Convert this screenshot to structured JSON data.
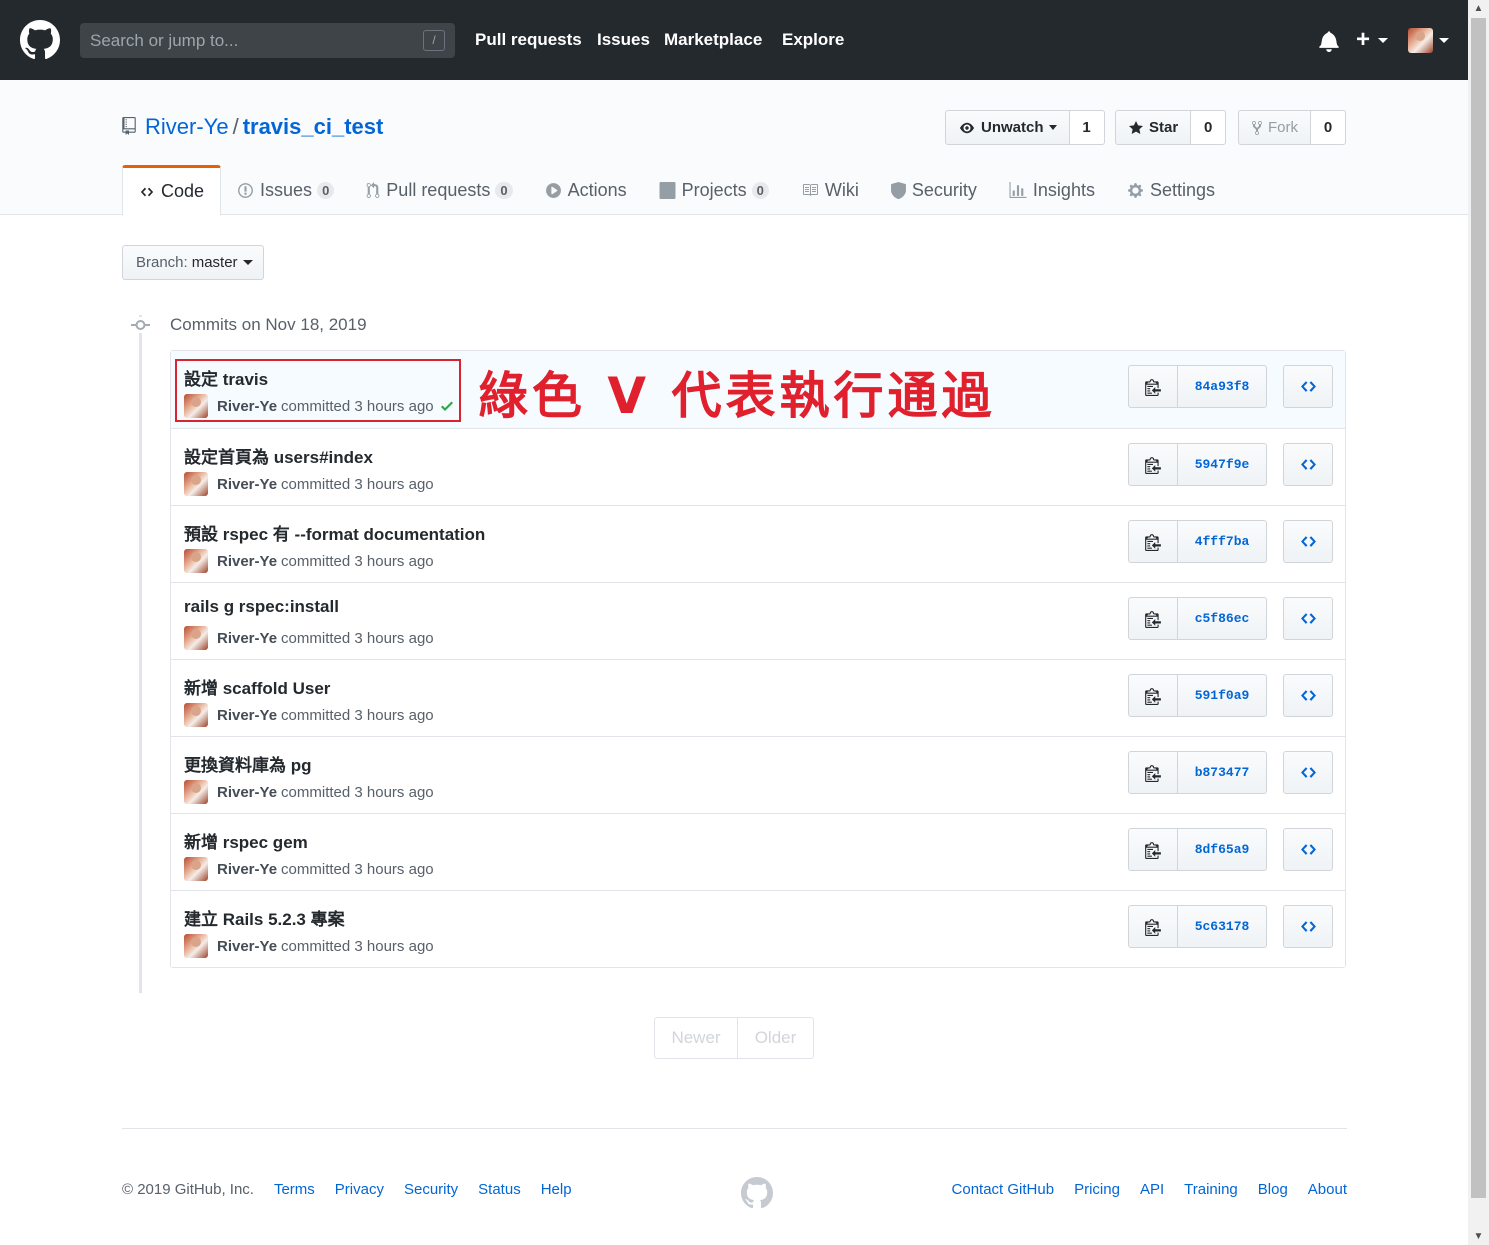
{
  "header": {
    "search_placeholder": "Search or jump to...",
    "slash_key": "/",
    "nav": [
      "Pull requests",
      "Issues",
      "Marketplace",
      "Explore"
    ]
  },
  "repo": {
    "owner": "River-Ye",
    "separator": "/",
    "name": "travis_ci_test",
    "watch_label": "Unwatch",
    "watch_count": "1",
    "star_label": "Star",
    "star_count": "0",
    "fork_label": "Fork",
    "fork_count": "0"
  },
  "tabs": [
    {
      "label": "Code",
      "count": null,
      "icon": "code-icon"
    },
    {
      "label": "Issues",
      "count": "0",
      "icon": "issue-icon"
    },
    {
      "label": "Pull requests",
      "count": "0",
      "icon": "pull-request-icon"
    },
    {
      "label": "Actions",
      "count": null,
      "icon": "play-icon"
    },
    {
      "label": "Projects",
      "count": "0",
      "icon": "project-icon"
    },
    {
      "label": "Wiki",
      "count": null,
      "icon": "book-icon"
    },
    {
      "label": "Security",
      "count": null,
      "icon": "shield-icon"
    },
    {
      "label": "Insights",
      "count": null,
      "icon": "graph-icon"
    },
    {
      "label": "Settings",
      "count": null,
      "icon": "gear-icon"
    }
  ],
  "branch": {
    "label": "Branch:",
    "value": "master"
  },
  "commits_group_title": "Commits on Nov 18, 2019",
  "commits": [
    {
      "message": "設定 travis",
      "author": "River-Ye",
      "time": "committed 3 hours ago",
      "sha": "84a93f8",
      "status": "success"
    },
    {
      "message": "設定首頁為 users#index",
      "author": "River-Ye",
      "time": "committed 3 hours ago",
      "sha": "5947f9e",
      "status": ""
    },
    {
      "message": "預設 rspec 有 --format documentation",
      "author": "River-Ye",
      "time": "committed 3 hours ago",
      "sha": "4fff7ba",
      "status": ""
    },
    {
      "message": "rails g rspec:install",
      "author": "River-Ye",
      "time": "committed 3 hours ago",
      "sha": "c5f86ec",
      "status": ""
    },
    {
      "message": "新增 scaffold User",
      "author": "River-Ye",
      "time": "committed 3 hours ago",
      "sha": "591f0a9",
      "status": ""
    },
    {
      "message": "更換資料庫為 pg",
      "author": "River-Ye",
      "time": "committed 3 hours ago",
      "sha": "b873477",
      "status": ""
    },
    {
      "message": "新增 rspec gem",
      "author": "River-Ye",
      "time": "committed 3 hours ago",
      "sha": "8df65a9",
      "status": ""
    },
    {
      "message": "建立 Rails 5.2.3 專案",
      "author": "River-Ye",
      "time": "committed 3 hours ago",
      "sha": "5c63178",
      "status": ""
    }
  ],
  "annotation": "綠色 V 代表執行通過",
  "pagination": {
    "newer": "Newer",
    "older": "Older"
  },
  "footer": {
    "copyright": "© 2019 GitHub, Inc.",
    "left_links": [
      "Terms",
      "Privacy",
      "Security",
      "Status",
      "Help"
    ],
    "right_links": [
      "Contact GitHub",
      "Pricing",
      "API",
      "Training",
      "Blog",
      "About"
    ]
  },
  "colors": {
    "header_bg": "#24292e",
    "link": "#0366d6",
    "tab_accent": "#e36209",
    "success": "#28a745",
    "annotation": "#e0202c"
  }
}
